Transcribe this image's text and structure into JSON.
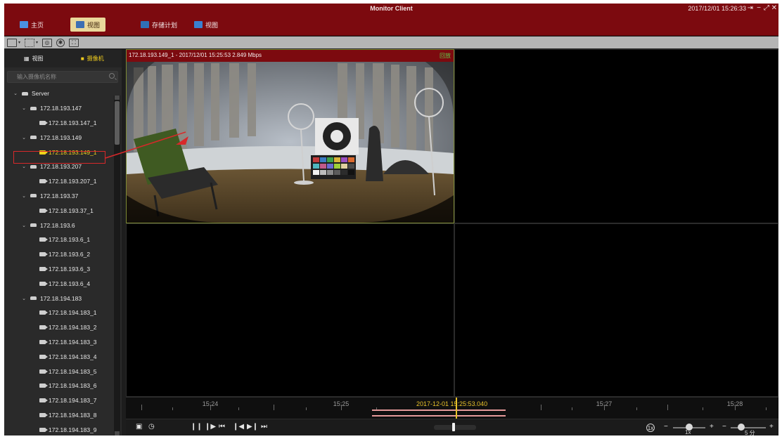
{
  "window": {
    "title": "Monitor Client",
    "datetime": "2017/12/01 15:26:33",
    "controls": [
      "⇥",
      "−",
      "⤢",
      "✕"
    ]
  },
  "tabs": [
    {
      "label": "主页",
      "active": false,
      "icon": "monitor-icon",
      "color": "#4a90e2"
    },
    {
      "label": "视图",
      "active": true,
      "icon": "camera-grid-icon",
      "color": "#3d6fb3"
    },
    {
      "label": "存储计划",
      "active": false,
      "icon": "storage-plan-icon",
      "color": "#2f6fb6"
    },
    {
      "label": "视图",
      "active": false,
      "icon": "monitor-icon",
      "color": "#3a80d0"
    }
  ],
  "toolbar": {
    "buttons": [
      "layout-single-icon",
      "layout-grid-icon",
      "snapshot-icon",
      "record-icon",
      "fullscreen-icon"
    ]
  },
  "sidebar": {
    "tabs": [
      {
        "label": "视图",
        "active": false,
        "icon": "grid-icon"
      },
      {
        "label": "摄像机",
        "active": true,
        "icon": "camera-icon"
      }
    ],
    "search_placeholder": "输入摄像机名称",
    "tree": [
      {
        "label": "Server",
        "level": 0,
        "type": "server",
        "expanded": true
      },
      {
        "label": "172.18.193.147",
        "level": 1,
        "type": "server",
        "expanded": true
      },
      {
        "label": "172.18.193.147_1",
        "level": 2,
        "type": "camera"
      },
      {
        "label": "172.18.193.149",
        "level": 1,
        "type": "server",
        "expanded": true
      },
      {
        "label": "172.18.193.149_1",
        "level": 2,
        "type": "camera",
        "selected": true
      },
      {
        "label": "172.18.193.207",
        "level": 1,
        "type": "server",
        "expanded": true
      },
      {
        "label": "172.18.193.207_1",
        "level": 2,
        "type": "camera"
      },
      {
        "label": "172.18.193.37",
        "level": 1,
        "type": "server",
        "expanded": true
      },
      {
        "label": "172.18.193.37_1",
        "level": 2,
        "type": "camera"
      },
      {
        "label": "172.18.193.6",
        "level": 1,
        "type": "server",
        "expanded": true
      },
      {
        "label": "172.18.193.6_1",
        "level": 2,
        "type": "camera"
      },
      {
        "label": "172.18.193.6_2",
        "level": 2,
        "type": "camera"
      },
      {
        "label": "172.18.193.6_3",
        "level": 2,
        "type": "camera"
      },
      {
        "label": "172.18.193.6_4",
        "level": 2,
        "type": "camera"
      },
      {
        "label": "172.18.194.183",
        "level": 1,
        "type": "server",
        "expanded": true
      },
      {
        "label": "172.18.194.183_1",
        "level": 2,
        "type": "camera"
      },
      {
        "label": "172.18.194.183_2",
        "level": 2,
        "type": "camera"
      },
      {
        "label": "172.18.194.183_3",
        "level": 2,
        "type": "camera"
      },
      {
        "label": "172.18.194.183_4",
        "level": 2,
        "type": "camera"
      },
      {
        "label": "172.18.194.183_5",
        "level": 2,
        "type": "camera"
      },
      {
        "label": "172.18.194.183_6",
        "level": 2,
        "type": "camera"
      },
      {
        "label": "172.18.194.183_7",
        "level": 2,
        "type": "camera"
      },
      {
        "label": "172.18.194.183_8",
        "level": 2,
        "type": "camera"
      },
      {
        "label": "172.18.194.183_9",
        "level": 2,
        "type": "camera"
      }
    ]
  },
  "video": {
    "header": "172.18.193.149_1 - 2017/12/01 15:25:53 2.849 Mbps",
    "status": "回放",
    "status_color": "#5ec94a"
  },
  "timeline": {
    "labels": [
      "15:24",
      "15:25",
      "15:27",
      "15:28"
    ],
    "cursor_label": "2017-12-01 15:25:53.040",
    "cursor_color": "#e8c22a",
    "record_color": "#e59a9a"
  },
  "controls": {
    "left_buttons": [
      "clip-icon",
      "clock-icon"
    ],
    "playback_buttons": [
      "pause-icon",
      "step-forward-icon",
      "skip-back-icon",
      "prev-frame-icon",
      "next-frame-icon",
      "skip-forward-icon"
    ],
    "speed_badge": "1x",
    "speed_label": "1x",
    "zoom_label": "5 分",
    "speed_level": 0.5,
    "zoom_level": 0.3
  },
  "colors": {
    "titlebar": "#7c0a0f",
    "active_tab": "#e9d79b",
    "selected_text": "#f0d21a",
    "selection_box": "#d8282a"
  }
}
